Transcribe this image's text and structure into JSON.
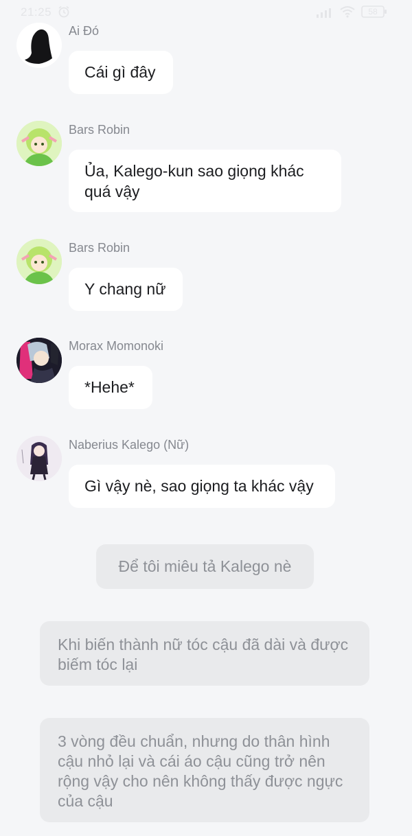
{
  "status_bar": {
    "time": "21:25",
    "battery": "58"
  },
  "messages": [
    {
      "sender": "Ai Đó",
      "text": "Cái gì đây"
    },
    {
      "sender": "Bars Robin",
      "text": "Ủa, Kalego-kun sao giọng khác quá vậy"
    },
    {
      "sender": "Bars Robin",
      "text": "Y chang nữ"
    },
    {
      "sender": "Morax Momonoki",
      "text": "*Hehe*"
    },
    {
      "sender": "Naberius Kalego (Nữ)",
      "text": "Gì vậy nè, sao giọng ta khác vậy"
    }
  ],
  "narration": [
    "Để tôi miêu tả Kalego nè",
    "Khi biến thành nữ tóc cậu đã dài và được biếm tóc lại",
    "3 vòng đều chuẩn, nhưng do thân hình cậu nhỏ lại và cái áo cậu cũng trở nên rộng vậy cho nên không thấy được ngực của cậu"
  ],
  "colors": {
    "background": "#f5f6f8",
    "bubble": "#ffffff",
    "narration_bubble": "#e9eaec",
    "sender_text": "#85888f",
    "narration_text": "#8e9197"
  }
}
